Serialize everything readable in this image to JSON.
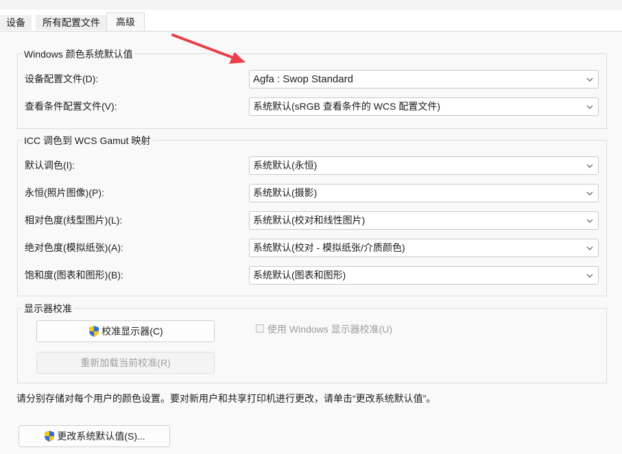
{
  "tabs": [
    {
      "label": "设备"
    },
    {
      "label": "所有配置文件"
    },
    {
      "label": "高级"
    }
  ],
  "active_tab": "高级",
  "wcs_defaults": {
    "legend": "Windows 颜色系统默认值",
    "rows": [
      {
        "label": "设备配置文件(D):",
        "value": "Agfa : Swop Standard"
      },
      {
        "label": "查看条件配置文件(V):",
        "value": "系统默认(sRGB 查看条件的 WCS 配置文件)"
      }
    ]
  },
  "gamut_mapping": {
    "legend": "ICC 调色到 WCS Gamut 映射",
    "rows": [
      {
        "label": "默认调色(I):",
        "value": "系统默认(永恒)"
      },
      {
        "label": "永恒(照片图像)(P):",
        "value": "系统默认(摄影)"
      },
      {
        "label": "相对色度(线型图片)(L):",
        "value": "系统默认(校对和线性图片)"
      },
      {
        "label": "绝对色度(模拟纸张)(A):",
        "value": "系统默认(校对 - 模拟纸张/介质颜色)"
      },
      {
        "label": "饱和度(图表和图形)(B):",
        "value": "系统默认(图表和图形)"
      }
    ]
  },
  "calibration": {
    "legend": "显示器校准",
    "calibrate_button": "校准显示器(C)",
    "reload_button": "重新加载当前校准(R)",
    "use_windows_calibration_label": "使用 Windows 显示器校准(U)",
    "use_windows_calibration_checked": false
  },
  "footnote": "请分别存储对每个用户的颜色设置。要对新用户和共享打印机进行更改，请单击“更改系统默认值”。",
  "change_defaults_button": "更改系统默认值(S)...",
  "colors": {
    "annotation_arrow": "#e8404a",
    "shield_blue": "#2f6fd6",
    "shield_yellow": "#f5c518"
  },
  "icons": [
    "chevron-down-icon",
    "uac-shield-icon",
    "annotation-arrow"
  ]
}
